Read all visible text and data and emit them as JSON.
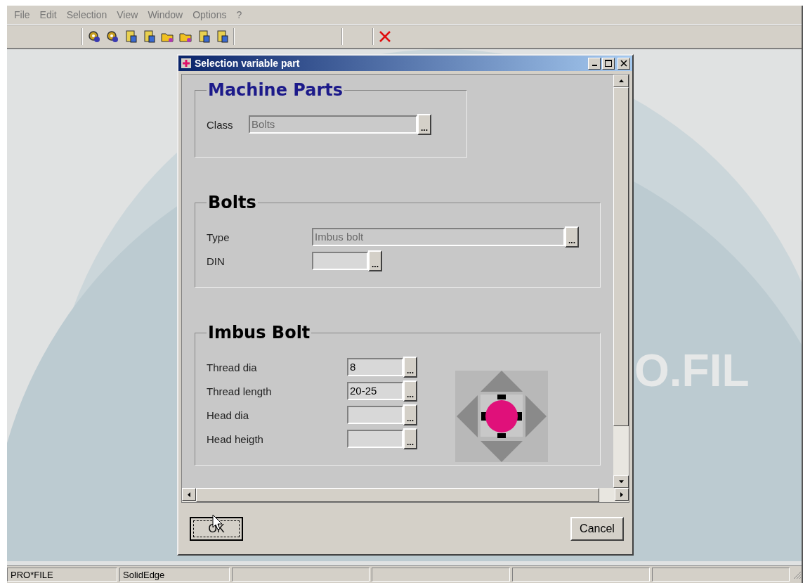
{
  "menu": [
    {
      "label": "File",
      "disabled": true
    },
    {
      "label": "Edit",
      "disabled": true
    },
    {
      "label": "Selection",
      "disabled": true
    },
    {
      "label": "View",
      "disabled": true
    },
    {
      "label": "Window",
      "disabled": true
    },
    {
      "label": "Options",
      "disabled": true
    },
    {
      "label": "?",
      "disabled": true
    }
  ],
  "backdrop": {
    "logo_text": "O.FIL"
  },
  "dialog": {
    "title": "Selection variable part",
    "groups": [
      {
        "title": "Machine Parts",
        "color": "#1c1a8a",
        "fields": [
          {
            "label": "Class",
            "value": "Bolts",
            "disabled": true,
            "button": "..."
          }
        ]
      },
      {
        "title": "Bolts",
        "color": "#000000",
        "fields": [
          {
            "label": "Type",
            "value": "Imbus bolt",
            "disabled": true,
            "button": "..."
          },
          {
            "label": "DIN",
            "disabled": false,
            "button": "..."
          }
        ]
      },
      {
        "title": "Imbus Bolt",
        "color": "#000000",
        "fields": [
          {
            "label": "Thread dia",
            "value": "8",
            "disabled": false,
            "button": "..."
          },
          {
            "label": "Thread length",
            "value": "20-25",
            "disabled": false,
            "button": "..."
          },
          {
            "label": "Head dia",
            "disabled": false,
            "button": "..."
          },
          {
            "label": "Head heigth",
            "disabled": false,
            "button": "..."
          }
        ]
      }
    ],
    "buttons": [
      {
        "label": "OK",
        "focused": true
      },
      {
        "label": "Cancel",
        "focused": false
      }
    ]
  },
  "status_bar": [
    {
      "text": "PRO*FILE"
    },
    {
      "text": "SolidEdge"
    }
  ]
}
